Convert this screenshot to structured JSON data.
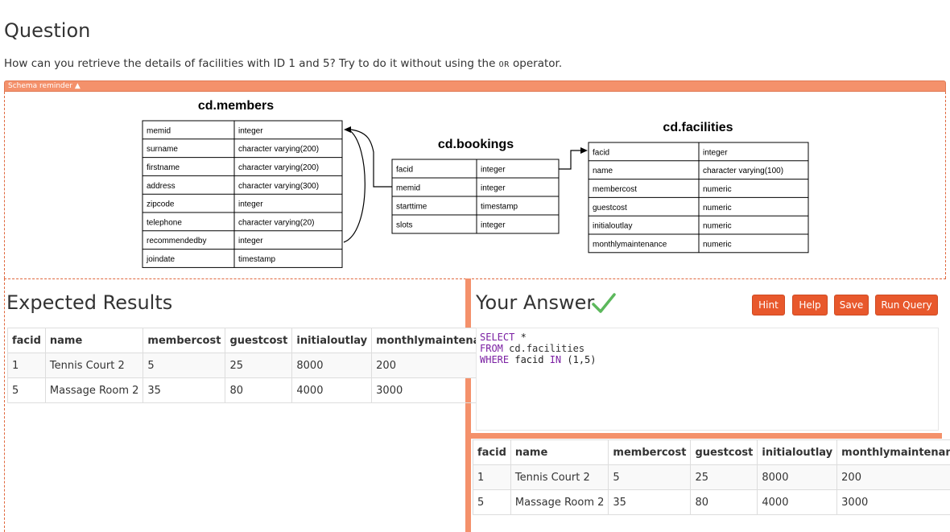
{
  "question": {
    "title": "Question",
    "text_before": "How can you retrieve the details of facilities with ID 1 and 5? Try to do it without using the ",
    "code": "OR",
    "text_after": " operator."
  },
  "schema": {
    "toggle_label": "Schema reminder ▲",
    "members": {
      "title": "cd.members",
      "rows": [
        [
          "memid",
          "integer"
        ],
        [
          "surname",
          "character varying(200)"
        ],
        [
          "firstname",
          "character varying(200)"
        ],
        [
          "address",
          "character varying(300)"
        ],
        [
          "zipcode",
          "integer"
        ],
        [
          "telephone",
          "character varying(20)"
        ],
        [
          "recommendedby",
          "integer"
        ],
        [
          "joindate",
          "timestamp"
        ]
      ]
    },
    "bookings": {
      "title": "cd.bookings",
      "rows": [
        [
          "facid",
          "integer"
        ],
        [
          "memid",
          "integer"
        ],
        [
          "starttime",
          "timestamp"
        ],
        [
          "slots",
          "integer"
        ]
      ]
    },
    "facilities": {
      "title": "cd.facilities",
      "rows": [
        [
          "facid",
          "integer"
        ],
        [
          "name",
          "character varying(100)"
        ],
        [
          "membercost",
          "numeric"
        ],
        [
          "guestcost",
          "numeric"
        ],
        [
          "initialoutlay",
          "numeric"
        ],
        [
          "monthlymaintenance",
          "numeric"
        ]
      ]
    }
  },
  "expected": {
    "title": "Expected Results",
    "columns": [
      "facid",
      "name",
      "membercost",
      "guestcost",
      "initialoutlay",
      "monthlymaintenance"
    ],
    "rows": [
      [
        "1",
        "Tennis Court 2",
        "5",
        "25",
        "8000",
        "200"
      ],
      [
        "5",
        "Massage Room 2",
        "35",
        "80",
        "4000",
        "3000"
      ]
    ]
  },
  "answer": {
    "title": "Your Answer",
    "buttons": {
      "hint": "Hint",
      "help": "Help",
      "save": "Save",
      "run": "Run Query"
    },
    "sql": {
      "line1_kw": "SELECT",
      "line1_rest": " *",
      "line2_kw": "FROM",
      "line2_schema": " cd.",
      "line2_table": "facilities",
      "line3_kw1": "WHERE",
      "line3_mid": " facid ",
      "line3_kw2": "IN",
      "line3_rest": " (1,5)"
    },
    "columns": [
      "facid",
      "name",
      "membercost",
      "guestcost",
      "initialoutlay",
      "monthlymaintenance"
    ],
    "rows": [
      [
        "1",
        "Tennis Court 2",
        "5",
        "25",
        "8000",
        "200"
      ],
      [
        "5",
        "Massage Room 2",
        "35",
        "80",
        "4000",
        "3000"
      ]
    ]
  },
  "colors": {
    "accent": "#e8582c",
    "splitter": "#f4916b",
    "check": "#5cb85c",
    "keyword": "#7a1fa2"
  }
}
